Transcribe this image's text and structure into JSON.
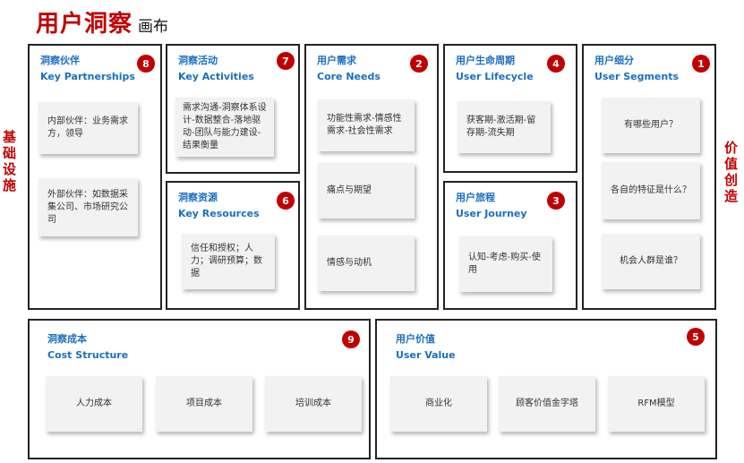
{
  "header": {
    "title": "用户洞察",
    "subtitle": "画布"
  },
  "side_labels": {
    "left": "基础设施",
    "right": "价值创造"
  },
  "boxes": {
    "partners": {
      "cn": "洞察伙伴",
      "en": "Key Partnerships",
      "num": "8",
      "notes": [
        "内部伙伴：业务需求方，领导",
        "外部伙伴：如数据采集公司、市场研究公司"
      ]
    },
    "activities": {
      "cn": "洞察活动",
      "en": "Key Activities",
      "num": "7",
      "notes": [
        "需求沟通-洞察体系设计-数据整合-落地驱动-团队与能力建设-结果衡量"
      ]
    },
    "resources": {
      "cn": "洞察资源",
      "en": "Key Resources",
      "num": "6",
      "notes": [
        "信任和授权；人力；调研预算；数据"
      ]
    },
    "needs": {
      "cn": "用户需求",
      "en": "Core Needs",
      "num": "2",
      "notes": [
        "功能性需求-情感性需求-社会性需求",
        "痛点与期望",
        "情感与动机"
      ]
    },
    "lifecycle": {
      "cn": "用户生命周期",
      "en": "User Lifecycle",
      "num": "4",
      "notes": [
        "获客期-激活期-留存期-流失期"
      ]
    },
    "journey": {
      "cn": "用户旅程",
      "en": "User Journey",
      "num": "3",
      "notes": [
        "认知-考虑-购买-使用"
      ]
    },
    "segments": {
      "cn": "用户细分",
      "en": "User Segments",
      "num": "1",
      "notes": [
        "有哪些用户？",
        "各自的特征是什么？",
        "机会人群是谁？"
      ]
    },
    "cost": {
      "cn": "洞察成本",
      "en": "Cost Structure",
      "num": "9",
      "notes": [
        "人力成本",
        "项目成本",
        "培训成本"
      ]
    },
    "value": {
      "cn": "用户价值",
      "en": "User Value",
      "num": "5",
      "notes": [
        "商业化",
        "顾客价值金字塔",
        "RFM模型"
      ]
    }
  }
}
